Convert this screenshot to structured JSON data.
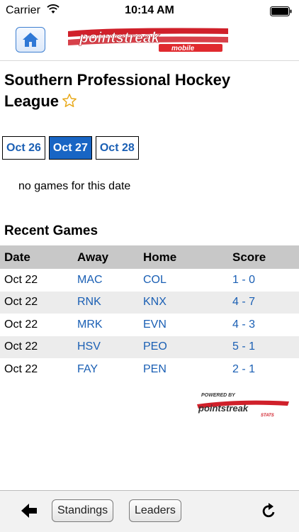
{
  "status": {
    "carrier": "Carrier",
    "time": "10:14 AM"
  },
  "header": {
    "home_icon": "house-icon",
    "logo_text": "pointstreak",
    "logo_subtext": "mobile"
  },
  "league": {
    "title": "Southern Professional Hockey League",
    "favorite_icon": "star-outline-icon"
  },
  "dates": {
    "tabs": [
      {
        "label": "Oct 26",
        "active": false
      },
      {
        "label": "Oct 27",
        "active": true
      },
      {
        "label": "Oct 28",
        "active": false
      }
    ]
  },
  "message": "no games for this date",
  "recent": {
    "title": "Recent Games",
    "columns": [
      "Date",
      "Away",
      "Home",
      "Score"
    ],
    "rows": [
      {
        "date": "Oct 22",
        "away": "MAC",
        "home": "COL",
        "score": "1 - 0"
      },
      {
        "date": "Oct 22",
        "away": "RNK",
        "home": "KNX",
        "score": "4 - 7"
      },
      {
        "date": "Oct 22",
        "away": "MRK",
        "home": "EVN",
        "score": "4 - 3"
      },
      {
        "date": "Oct 22",
        "away": "HSV",
        "home": "PEO",
        "score": "5 - 1"
      },
      {
        "date": "Oct 22",
        "away": "FAY",
        "home": "PEN",
        "score": "2 - 1"
      }
    ]
  },
  "powered_by": {
    "line1": "POWERED BY",
    "line2": "pointstreak",
    "line3": "STATS"
  },
  "toolbar": {
    "back_icon": "arrow-left-icon",
    "standings_label": "Standings",
    "leaders_label": "Leaders",
    "refresh_icon": "refresh-icon"
  },
  "colors": {
    "link": "#1a5fb4",
    "active_tab": "#1865c4",
    "brand_red": "#d0202a"
  }
}
